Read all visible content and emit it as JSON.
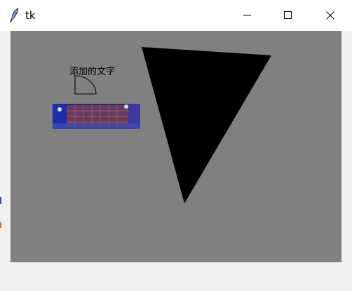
{
  "window": {
    "title": "tk",
    "app_icon": "tk-feather-icon",
    "controls": {
      "minimize_icon": "minimize-icon",
      "maximize_icon": "maximize-icon",
      "close_icon": "close-icon"
    }
  },
  "canvas": {
    "background": "#808080",
    "text_item": "添加的文字",
    "arc_item": "quarter-circle-arc",
    "image_item": "game-banner-image",
    "polygon_item": "black-triangle",
    "polygon_fill": "#000000"
  }
}
